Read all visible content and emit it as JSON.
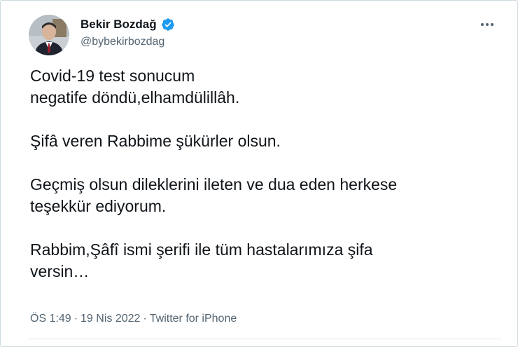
{
  "author": {
    "display_name": "Bekir Bozdağ",
    "handle": "@bybekirbozdag",
    "verified_icon": "verified-badge-icon",
    "verified_color": "#1d9bf0"
  },
  "tweet": {
    "paragraphs": [
      "Covid-19 test sonucum\nnegatife döndü,elhamdülillâh.",
      "Şifâ veren Rabbime şükürler olsun.",
      "Geçmiş olsun dileklerini ileten ve dua eden herkese\nteşekkür ediyorum.",
      "Rabbim,Şâfî ismi şerifi ile tüm hastalarımıza şifa\nversin…"
    ]
  },
  "meta": {
    "time": "ÖS 1:49",
    "separator": "·",
    "date": "19 Nis 2022",
    "source": "Twitter for iPhone"
  },
  "menu": {
    "icon": "more-options-icon"
  }
}
